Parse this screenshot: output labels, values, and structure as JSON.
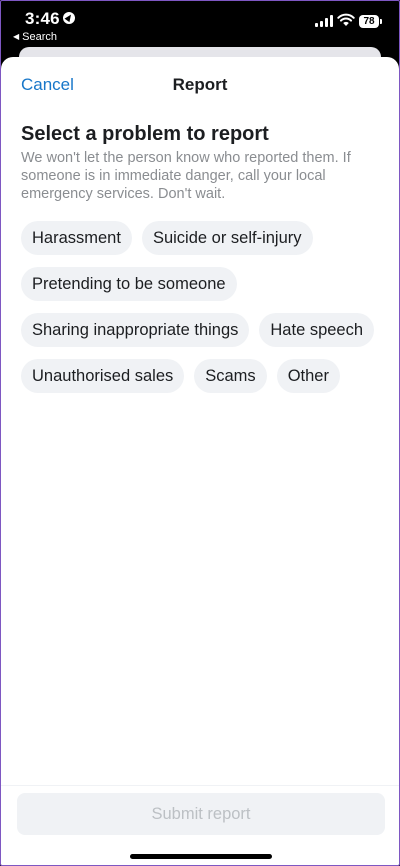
{
  "status_bar": {
    "time": "3:46",
    "back_label": "Search",
    "battery": "78"
  },
  "nav": {
    "cancel_label": "Cancel",
    "title": "Report"
  },
  "content": {
    "heading": "Select a problem to report",
    "description": "We won't let the person know who reported them. If someone is in immediate danger, call your local emergency services. Don't wait."
  },
  "options": [
    [
      "Harassment",
      "Suicide or self-injury"
    ],
    [
      "Pretending to be someone"
    ],
    [
      "Sharing inappropriate things",
      "Hate speech"
    ],
    [
      "Unauthorised sales",
      "Scams",
      "Other"
    ]
  ],
  "footer": {
    "submit_label": "Submit report"
  },
  "colors": {
    "accent": "#1877c9",
    "chip_background": "#f0f2f5",
    "disabled_text": "#bcc0c4"
  }
}
